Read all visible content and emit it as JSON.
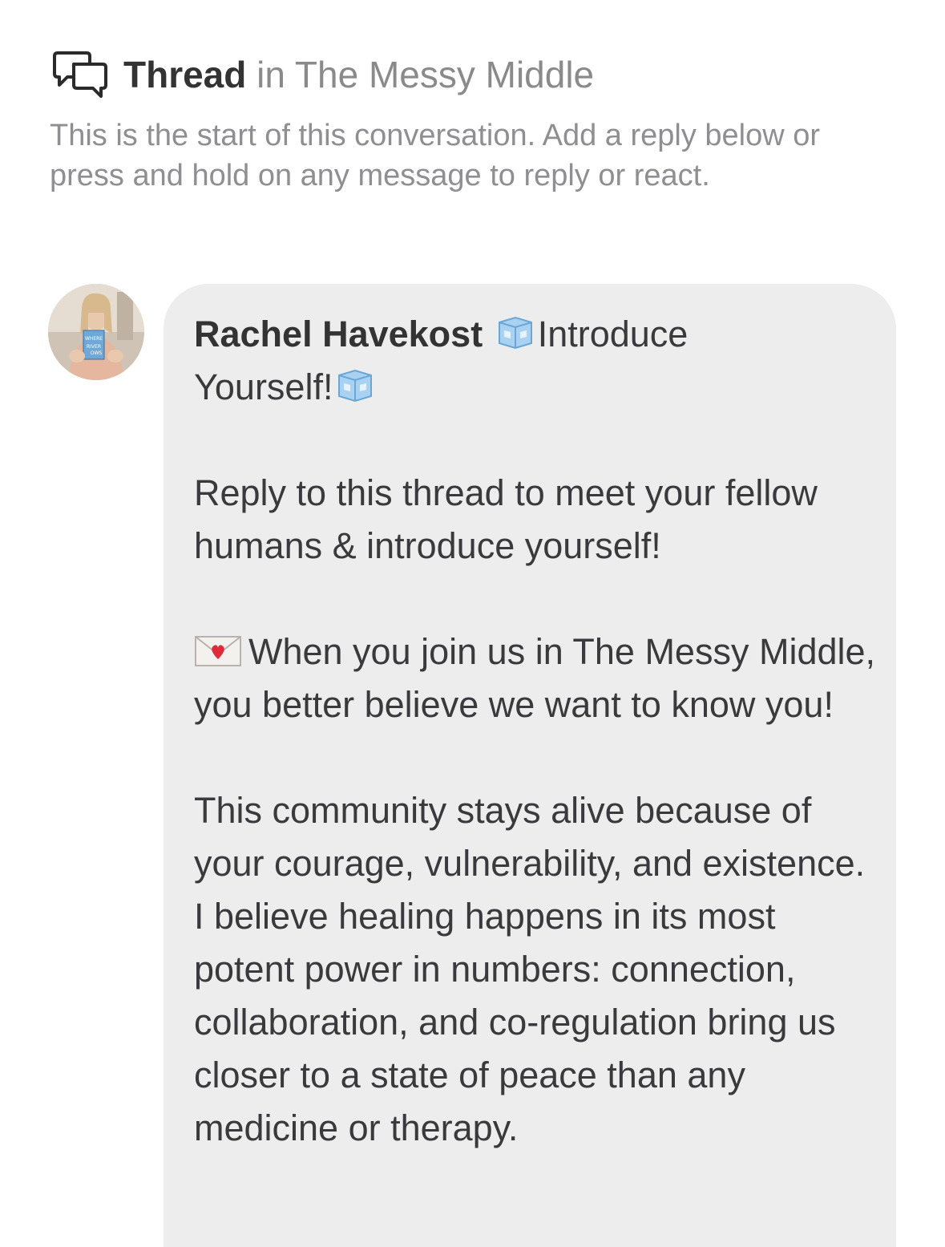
{
  "header": {
    "title_bold": "Thread",
    "title_rest": " in The Messy Middle",
    "icon": "speech-bubbles-icon"
  },
  "intro_text": "This is the start of this conversation. Add a reply below or press and hold on any message to reply or react.",
  "message": {
    "author": "Rachel Havekost",
    "title_part1": "Introduce",
    "title_part2": "Yourself!",
    "paragraph1": "Reply to this thread to meet your fellow humans & introduce yourself!",
    "paragraph2": "When you join us in The Messy Middle, you better believe we want to know you!",
    "paragraph3": "This community stays alive because of your courage, vulnerability, and existence. I believe healing happens in its most potent power in numbers: connection, collaboration, and co-regulation bring us closer to a state of peace than any medicine or therapy.",
    "emoji_title": "ice-cube-icon",
    "emoji_paragraph2": "love-letter-icon",
    "avatar_book_text": [
      "WHERE",
      "RIVER",
      "OWS"
    ]
  },
  "colors": {
    "bubble_bg": "#ededee",
    "intro_gray": "#8e8e93",
    "text_dark": "#3a3a3c"
  }
}
